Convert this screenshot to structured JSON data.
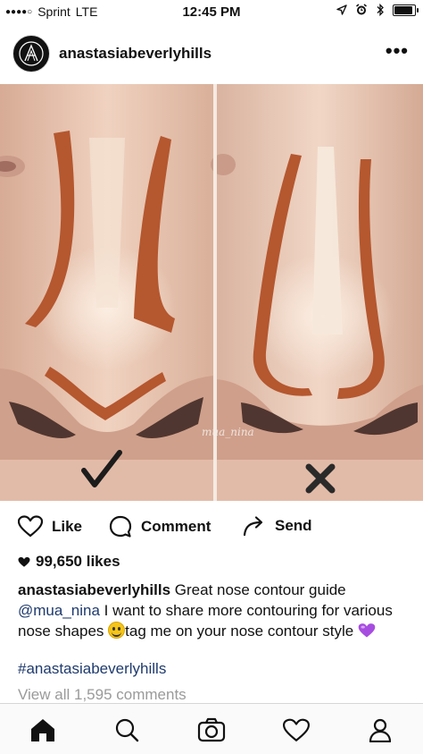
{
  "status_bar": {
    "carrier": "Sprint",
    "network": "LTE",
    "time": "12:45 PM",
    "signal_dots": "●●●●○",
    "battery_level": 0.85
  },
  "post": {
    "username": "anastasiabeverlyhills",
    "more_label": "•••",
    "photo": {
      "watermark": "mua_nina",
      "left_mark": "check-icon",
      "right_mark": "cross-icon"
    },
    "actions": {
      "like_label": "Like",
      "comment_label": "Comment",
      "send_label": "Send"
    },
    "likes_text": "99,650 likes",
    "caption": {
      "username": "anastasiabeverlyhills",
      "text_1": "Great nose contour guide",
      "mention": "@mua_nina",
      "text_2": " I want to share more contouring for various nose shapes ",
      "text_3": "tag me on your nose contour style "
    },
    "hashtag": "#anastasiabeverlyhills",
    "view_comments": "View all 1,595 comments"
  },
  "tab_bar": {
    "items": [
      "home-icon",
      "search-icon",
      "camera-icon",
      "heart-icon",
      "profile-icon"
    ],
    "active": "home-icon"
  },
  "colors": {
    "link": "#1e3a6e",
    "muted": "#9a9a9a",
    "contour": "#b5572f",
    "skin": "#e8c4ad",
    "emoji_heart": "#a64de0"
  }
}
